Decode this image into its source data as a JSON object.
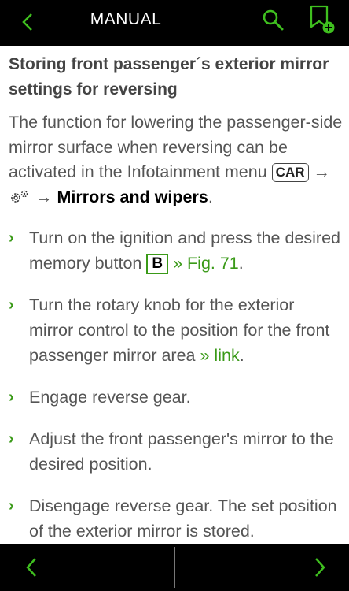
{
  "header": {
    "title": "MANUAL",
    "accent": "#3fbf1f"
  },
  "article": {
    "heading": "Storing front passenger´s exterior mirror settings for reversing",
    "intro_text": "The function for lowering the passenger-side mirror surface when reversing can be activated in the Infotainment menu",
    "car_key": "CAR",
    "arrow": "→",
    "settings_icon": "settings-gear-icon",
    "menu_item": "Mirrors and wipers",
    "period": "."
  },
  "steps": [
    {
      "text_before": "Turn on the ignition and press the desired memory button",
      "key": "B",
      "link": "» Fig. 71",
      "text_after": "."
    },
    {
      "text_before": "Turn the rotary knob for the exterior mirror control to the position for the front passenger mirror area",
      "link": "» link",
      "text_after": "."
    },
    {
      "text_before": "Engage reverse gear."
    },
    {
      "text_before": "Adjust the front passenger's mirror to the desired position."
    },
    {
      "text_before": "Disengage reverse gear. The set position of the exterior mirror is stored."
    }
  ],
  "bullet": "›",
  "footer": {
    "prev_icon": "chevron-left-icon",
    "next_icon": "chevron-right-icon"
  }
}
